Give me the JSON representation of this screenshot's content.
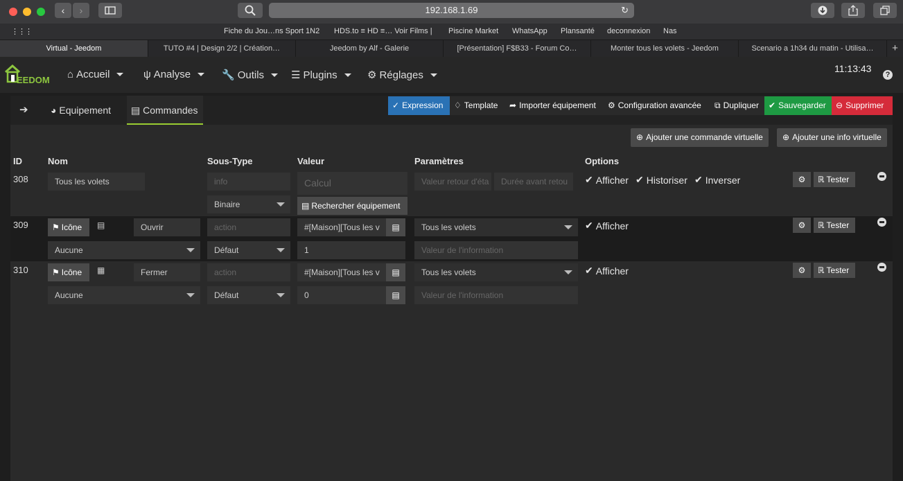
{
  "browser": {
    "url": "192.168.1.69",
    "favorites": [
      "Fiche du Jou…ns Sport 1N2",
      "HDS.to ≡ HD ≡… Voir Films |",
      "Piscine Market",
      "WhatsApp",
      "Plansanté",
      "deconnexion",
      "Nas"
    ],
    "tabs": [
      "Virtual - Jeedom",
      "TUTO #4 | Design 2/2 | Création…",
      "Jeedom by Alf - Galerie",
      "[Présentation] F$B33 - Forum Co…",
      "Monter tous les volets - Jeedom",
      "Scenario a 1h34 du matin - Utilisa…"
    ]
  },
  "nav": {
    "logo_text": "EEDOM",
    "items": [
      "Accueil",
      "Analyse",
      "Outils",
      "Plugins",
      "Réglages"
    ],
    "clock": "11:13:43"
  },
  "subtabs": {
    "equipement": "Equipement",
    "commandes": "Commandes"
  },
  "actions": {
    "expression": "Expression",
    "template": "Template",
    "importer": "Importer équipement",
    "config": "Configuration avancée",
    "dupliquer": "Dupliquer",
    "sauvegarder": "Sauvegarder",
    "supprimer": "Supprimer",
    "add_cmd": "Ajouter une commande virtuelle",
    "add_info": "Ajouter une info virtuelle"
  },
  "colors": {
    "expression": "#2a72b5",
    "sauvegarder": "#1e9a43",
    "supprimer": "#d52b3a",
    "accent": "#9acd32"
  },
  "table": {
    "headers": {
      "id": "ID",
      "nom": "Nom",
      "soustype": "Sous-Type",
      "valeur": "Valeur",
      "parametres": "Paramètres",
      "options": "Options"
    },
    "rows": [
      {
        "id": "308",
        "nom": "Tous les volets",
        "type_ph": "info",
        "subtype": "Binaire",
        "valeur_ph": "Calcul",
        "rechercher": "Rechercher équipement",
        "param1_ph": "Valeur retour d'éta",
        "param2_ph": "Durée avant retou",
        "opt_afficher": "Afficher",
        "opt_historiser": "Historiser",
        "opt_inverser": "Inverser",
        "configure_icon": "gears-icon",
        "tester": "Tester"
      },
      {
        "id": "309",
        "icone": "Icône",
        "nom": "Ouvrir",
        "type_ph": "action",
        "valeur": "#[Maison][Tous les v",
        "param": "Tous les volets",
        "generic": "Aucune",
        "subtype": "Défaut",
        "val2": "1",
        "info_ph": "Valeur de l'information",
        "opt_afficher": "Afficher",
        "tester": "Tester"
      },
      {
        "id": "310",
        "icone": "Icône",
        "nom": "Fermer",
        "type_ph": "action",
        "valeur": "#[Maison][Tous les v",
        "param": "Tous les volets",
        "generic": "Aucune",
        "subtype": "Défaut",
        "val2": "0",
        "info_ph": "Valeur de l'information",
        "opt_afficher": "Afficher",
        "tester": "Tester"
      }
    ]
  }
}
